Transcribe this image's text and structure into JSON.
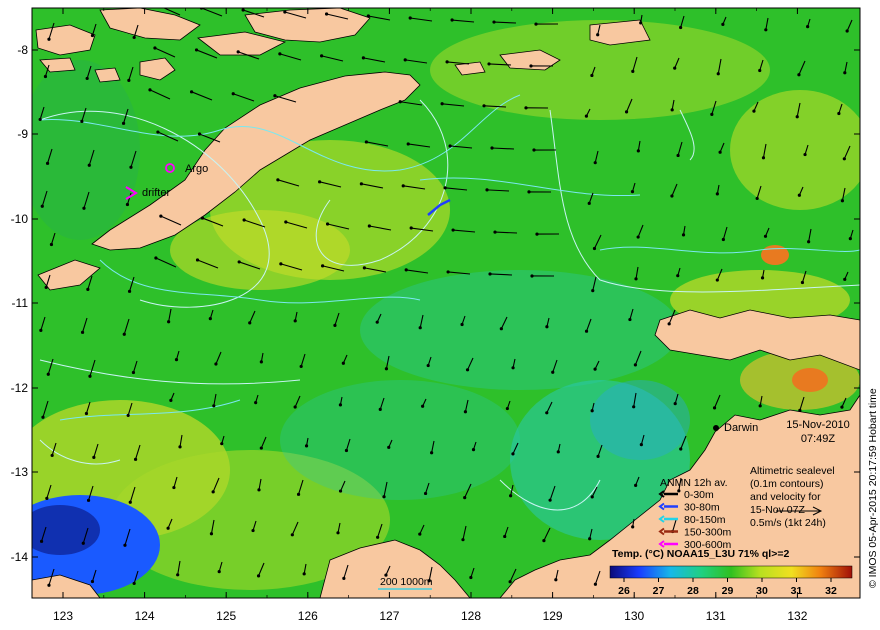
{
  "map": {
    "axes": {
      "lat_ticks": [
        "-8",
        "-9",
        "-10",
        "-11",
        "-12",
        "-13",
        "-14"
      ],
      "lon_ticks": [
        "123",
        "124",
        "125",
        "126",
        "127",
        "128",
        "129",
        "130",
        "131",
        "132"
      ]
    },
    "places": {
      "argo": "Argo",
      "drifter": "drifter",
      "darwin": "Darwin"
    },
    "timestamp": {
      "date": "15-Nov-2010",
      "time": "07:49Z"
    },
    "altimetry_note": {
      "line1": "Altimetric sealevel",
      "line2": "(0.1m contours)",
      "line3": "and velocity for",
      "line4": "15-Nov 07Z",
      "line5": "0.5m/s (1kt 24h)"
    },
    "anmn_legend": {
      "title": "ANMN 12h av.",
      "items": [
        {
          "label": "0-30m",
          "color": "#000000"
        },
        {
          "label": "30-80m",
          "color": "#1f3fff"
        },
        {
          "label": "80-150m",
          "color": "#22d3e8"
        },
        {
          "label": "150-300m",
          "color": "#9a2a10"
        },
        {
          "label": "300-600m",
          "color": "#ff00ff"
        }
      ]
    },
    "colorbar": {
      "title": "Temp. (°C) NOAA15_L3U 71% ql>=2",
      "ticks": [
        "26",
        "27",
        "28",
        "29",
        "30",
        "31",
        "32"
      ]
    },
    "scale_bar": {
      "label": "200  1000m"
    },
    "credit": "© IMOS 05-Apr-2015 20:17:59 Hobart time",
    "colors": {
      "land": "#f8c8a0",
      "sst_green": "#2ec02a",
      "sst_yellow": "#c8dc2a",
      "sst_cyan": "#29c8b0",
      "sst_blue": "#1a5aff",
      "sst_orange": "#e8a020",
      "contour": "#9ff0f0"
    }
  }
}
